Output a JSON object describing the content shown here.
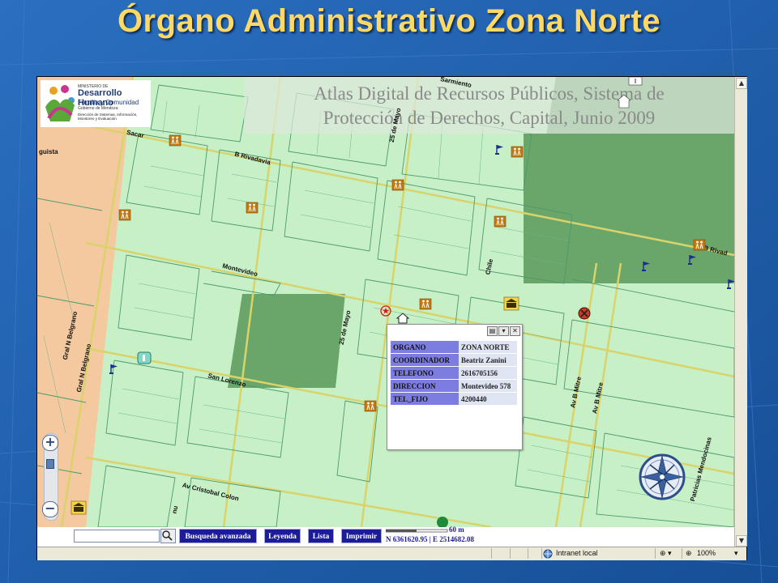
{
  "slide": {
    "title": "Órgano Administrativo Zona Norte"
  },
  "map": {
    "atlas_title_line1": "Atlas Digital de Recursos Públicos, Sistema de",
    "atlas_title_line2": "Protección de Derechos, Capital, Junio 2009",
    "logo": {
      "ministerio": "MINISTERIO DE",
      "name": "Desarrollo Humano",
      "subtitle": "Familia y Comunidad",
      "gobierno": "Gobierno de Mendoza",
      "direccion": "Dirección de Sistemas, Información, Monitoreo y Evaluación"
    },
    "streets": {
      "sarmiento": "Sarmiento",
      "rivadavia": "B Rivadavia",
      "rivadavia2": "B Rivad",
      "montevideo": "Montevideo",
      "san_lorenzo": "San Lorenzo",
      "colon": "Av Cristobal Colon",
      "belgrano1": "Gral N Belgrano",
      "belgrano2": "Gral N Belgrano",
      "mayo1": "25 de Mayo",
      "mayo2": "25 de Mayo",
      "chile": "Chile",
      "mitre1": "Av B Mitre",
      "mitre2": "Av B Mitre",
      "patricias": "Patricias Mendocinas",
      "sacar": "Sacar",
      "uruguista": "guista",
      "nu": "nu"
    }
  },
  "popup": {
    "rows": [
      {
        "key": "ORGANO",
        "value": "ZONA NORTE"
      },
      {
        "key": "COORDINADOR",
        "value": "Beatriz Zanini"
      },
      {
        "key": "TELEFONO",
        "value": "2616705156"
      },
      {
        "key": "DIRECCION",
        "value": "Montevideo 578"
      },
      {
        "key": "TEL_FIJO",
        "value": "4200440"
      }
    ]
  },
  "toolbar": {
    "search_value": "",
    "advanced_search": "Busqueda avanzada",
    "legend": "Leyenda",
    "list": "Lista",
    "print": "Imprimir",
    "scale": "60 m",
    "coordinates": "N 6361620.95 | E 2514682.08"
  },
  "statusbar": {
    "zone": "Intranet local",
    "zoom": "100%"
  },
  "colors": {
    "map_bg": "#c7f0c7",
    "park": "#6aa66a",
    "button_bg": "#1c1c9a",
    "title": "#ffd966"
  }
}
